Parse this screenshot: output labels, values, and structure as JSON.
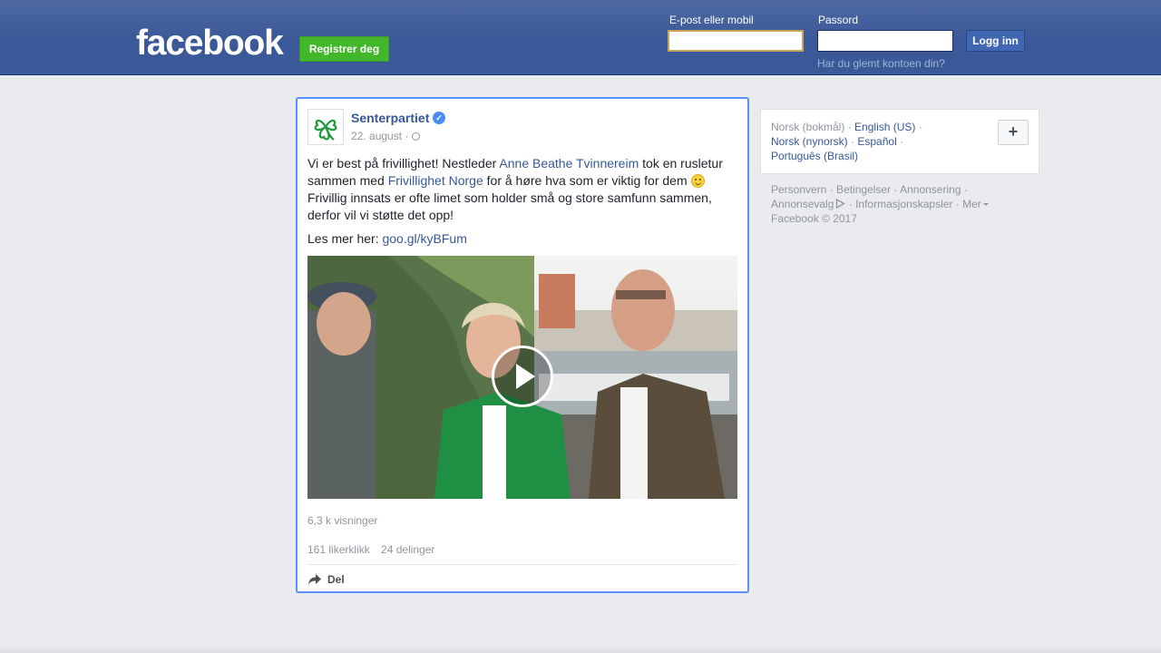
{
  "header": {
    "logo": "facebook",
    "register_label": "Registrer deg",
    "email_label": "E-post eller mobil",
    "email_value": "",
    "password_label": "Passord",
    "password_value": "",
    "login_label": "Logg inn",
    "forgot_label": "Har du glemt kontoen din?"
  },
  "post": {
    "page_name": "Senterpartiet",
    "verified_icon": "verified-check-icon",
    "date": "22. august",
    "date_separator": "·",
    "privacy_icon": "globe-icon",
    "text": {
      "part1": "Vi er best på frivillighet! Nestleder ",
      "link1": "Anne Beathe Tvinnereim",
      "part2": " tok en rusletur sammen med ",
      "link2": "Frivillighet Norge",
      "part3": " for å høre hva som er viktig for dem ",
      "part4": " Frivillig innsats er ofte limet som holder små og store samfunn sammen, derfor vil vi støtte det opp!"
    },
    "read_more_label": "Les mer her:",
    "read_more_link": "goo.gl/kyBFum",
    "views": "6,3 k visninger",
    "likes": "161 likerklikk",
    "shares": "24 delinger",
    "share_label": "Del"
  },
  "languages": {
    "current": "Norsk (bokmål)",
    "items": [
      "English (US)",
      "Norsk (nynorsk)",
      "Español",
      "Português (Brasil)"
    ],
    "add_label": "+"
  },
  "footer": {
    "links": [
      "Personvern",
      "Betingelser",
      "Annonsering",
      "Annonsevalg",
      "Informasjonskapsler",
      "Mer"
    ],
    "copyright": "Facebook © 2017"
  },
  "colors": {
    "brand_blue": "#3b5998",
    "register_green": "#42b72a",
    "link_blue": "#365899",
    "focus_border": "#5890ff"
  }
}
